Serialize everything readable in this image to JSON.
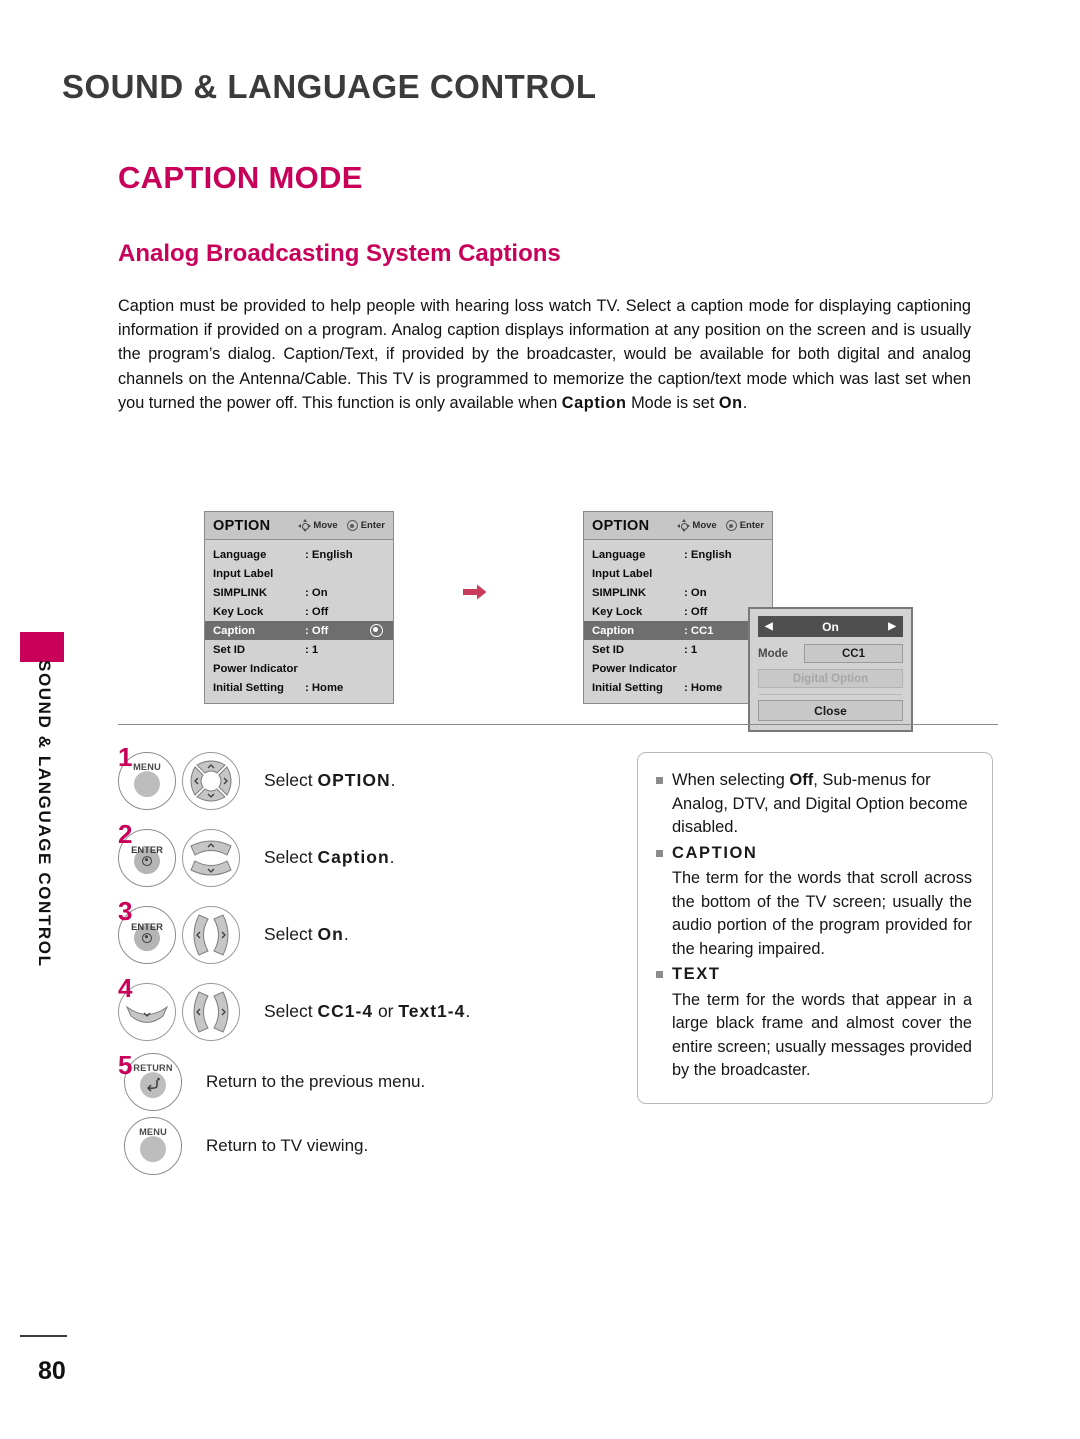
{
  "header": {
    "chapter": "SOUND & LANGUAGE CONTROL",
    "section": "CAPTION MODE",
    "subsection": "Analog Broadcasting System Captions"
  },
  "intro": {
    "part1": "Caption must be provided to help people with hearing loss watch TV. Select a caption mode for displaying captioning information if provided on a program. Analog caption displays information at any position on the screen and is usually the program’s dialog. Caption/Text, if provided by the broadcaster, would be available for both digital and analog channels on the Antenna/Cable. This TV is programmed to memorize the caption/text mode which was last set when you turned the power off. This function is only available when ",
    "bold1": "Caption",
    "part2": " Mode is set ",
    "bold2": "On",
    "part3": "."
  },
  "spine": {
    "label": "SOUND & LANGUAGE CONTROL",
    "accent_color": "#c9005a"
  },
  "osd_left": {
    "title": "OPTION",
    "hint_move": "Move",
    "hint_enter": "Enter",
    "rows": [
      {
        "label": "Language",
        "value": ": English",
        "selected": false
      },
      {
        "label": "Input Label",
        "value": "",
        "selected": false
      },
      {
        "label": "SIMPLINK",
        "value": ": On",
        "selected": false
      },
      {
        "label": "Key Lock",
        "value": ": Off",
        "selected": false
      },
      {
        "label": "Caption",
        "value": ": Off",
        "selected": true
      },
      {
        "label": "Set ID",
        "value": ": 1",
        "selected": false
      },
      {
        "label": "Power Indicator",
        "value": "",
        "selected": false
      },
      {
        "label": "Initial Setting",
        "value": ": Home",
        "selected": false
      }
    ]
  },
  "osd_right": {
    "title": "OPTION",
    "hint_move": "Move",
    "hint_enter": "Enter",
    "rows": [
      {
        "label": "Language",
        "value": ": English",
        "selected": false
      },
      {
        "label": "Input Label",
        "value": "",
        "selected": false
      },
      {
        "label": "SIMPLINK",
        "value": ": On",
        "selected": false
      },
      {
        "label": "Key Lock",
        "value": ": Off",
        "selected": false
      },
      {
        "label": "Caption",
        "value": ": CC1",
        "selected": true
      },
      {
        "label": "Set ID",
        "value": ": 1",
        "selected": false
      },
      {
        "label": "Power Indicator",
        "value": "",
        "selected": false
      },
      {
        "label": "Initial Setting",
        "value": ": Home",
        "selected": false
      }
    ]
  },
  "subpanel": {
    "onoff_value": "On",
    "arrow_left": "◀",
    "arrow_right": "▶",
    "mode_label": "Mode",
    "mode_value": "CC1",
    "digital_option": "Digital Option",
    "close": "Close"
  },
  "steps": [
    {
      "num": "1",
      "button": "MENU",
      "nav": "dpad",
      "text_pre": "Select ",
      "text_bold": "OPTION",
      "text_post": "."
    },
    {
      "num": "2",
      "button": "ENTER",
      "nav": "updown",
      "text_pre": "Select ",
      "text_bold": "Caption",
      "text_post": "."
    },
    {
      "num": "3",
      "button": "ENTER",
      "nav": "leftright",
      "text_pre": "Select ",
      "text_bold": "On",
      "text_post": "."
    },
    {
      "num": "4",
      "button": "down",
      "nav": "leftright",
      "text_pre": "Select ",
      "text_bold": "CC1-4",
      "text_mid": " or ",
      "text_bold2": "Text1-4",
      "text_post": "."
    }
  ],
  "steps_tail": [
    {
      "num": "5",
      "button": "RETURN",
      "text": "Return to the previous menu."
    },
    {
      "num": "",
      "button": "MENU",
      "text": "Return to TV viewing."
    }
  ],
  "notes": {
    "item1": {
      "pre": "When selecting ",
      "bold": "Off",
      "post": ", Sub-menus for Analog, DTV, and Digital Option become disabled."
    },
    "caption_head": "CAPTION",
    "caption_body": "The term for the words that scroll across the bottom of the TV screen; usually the audio portion of the program provided for the hearing impaired.",
    "text_head": "TEXT",
    "text_body": "The term for the words that appear in a large black frame and almost cover the entire screen; usually messages provided by the broadcaster."
  },
  "footer": {
    "page_number": "80"
  }
}
